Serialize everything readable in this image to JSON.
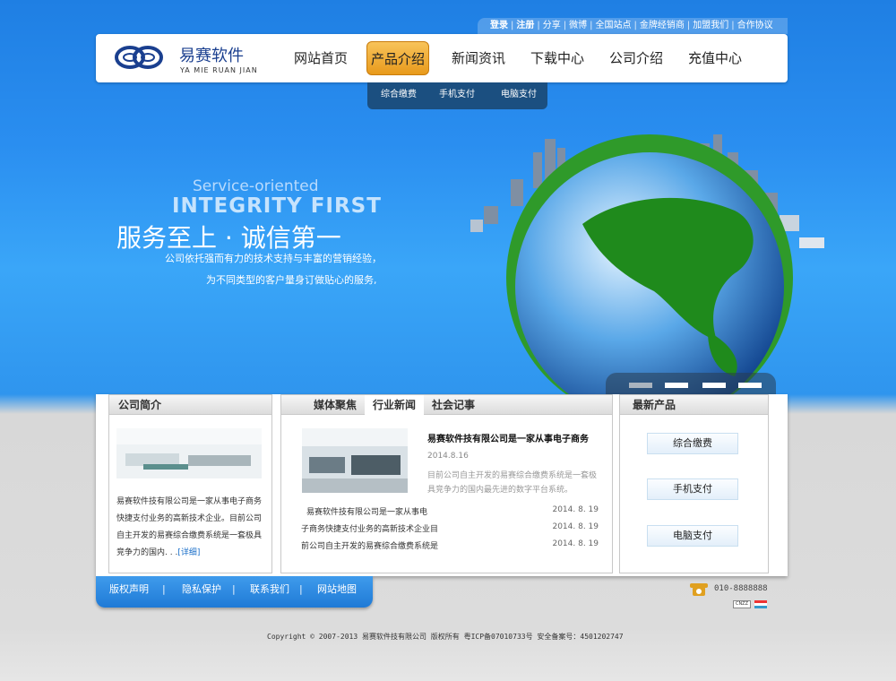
{
  "top_links": [
    "登录",
    "注册",
    "分享",
    "微博",
    "全国站点",
    "金牌经销商",
    "加盟我们",
    "合作协议"
  ],
  "logo": {
    "name": "易赛软件",
    "sub": "YA MIE RUAN JIAN"
  },
  "nav": [
    {
      "label": "网站首页"
    },
    {
      "label": "产品介绍",
      "active": true
    },
    {
      "label": "新闻资讯"
    },
    {
      "label": "下载中心"
    },
    {
      "label": "公司介绍"
    },
    {
      "label": "充值中心"
    }
  ],
  "subnav": [
    "综合缴费",
    "手机支付",
    "电脑支付"
  ],
  "hero": {
    "sub_en": "Service-oriented",
    "big_en": "INTEGRITY FIRST",
    "title_cn": "服务至上 · 诚信第一",
    "line1": "公司依托强而有力的技术支持与丰富的营销经验，",
    "line2": "为不同类型的客户量身订做贴心的服务,"
  },
  "about": {
    "title": "公司简介",
    "text": "易赛软件技有限公司是一家从事电子商务快捷支付业务的高新技术企业。目前公司自主开发的易赛综合缴费系统是一套极具竞争力的国内. . .",
    "more": "[详细]"
  },
  "news": {
    "tabs": [
      "媒体聚焦",
      "行业新闻",
      "社会记事"
    ],
    "active_tab": 1,
    "featured": {
      "title": "易赛软件技有限公司是一家从事电子商务",
      "date": "2014.8.16",
      "desc": "目前公司自主开发的易赛综合缴费系统是一套极具竞争力的国内最先进的数字平台系统。"
    },
    "items": [
      {
        "title": "易赛软件技有限公司是一家从事电",
        "date": "2014. 8. 19"
      },
      {
        "title": "子商务快捷支付业务的高新技术企业目",
        "date": "2014. 8. 19"
      },
      {
        "title": "前公司自主开发的易赛综合缴费系统是",
        "date": "2014. 8. 19"
      }
    ]
  },
  "products": {
    "title": "最新产品",
    "items": [
      "综合缴费",
      "手机支付",
      "电脑支付"
    ]
  },
  "footer": {
    "links": [
      "版权声明",
      "隐私保护",
      "联系我们",
      "网站地图"
    ],
    "phone": "010-8888888",
    "cnzz": "CNZZ",
    "copyright": "Copyright © 2007-2013 易赛软件技有限公司 版权所有 粤ICP备07010733号 安全备案号：4501202747"
  },
  "colors": {
    "accent": "#2a8ef0",
    "nav_active": "#f0a830",
    "brand": "#1a3f8f"
  }
}
